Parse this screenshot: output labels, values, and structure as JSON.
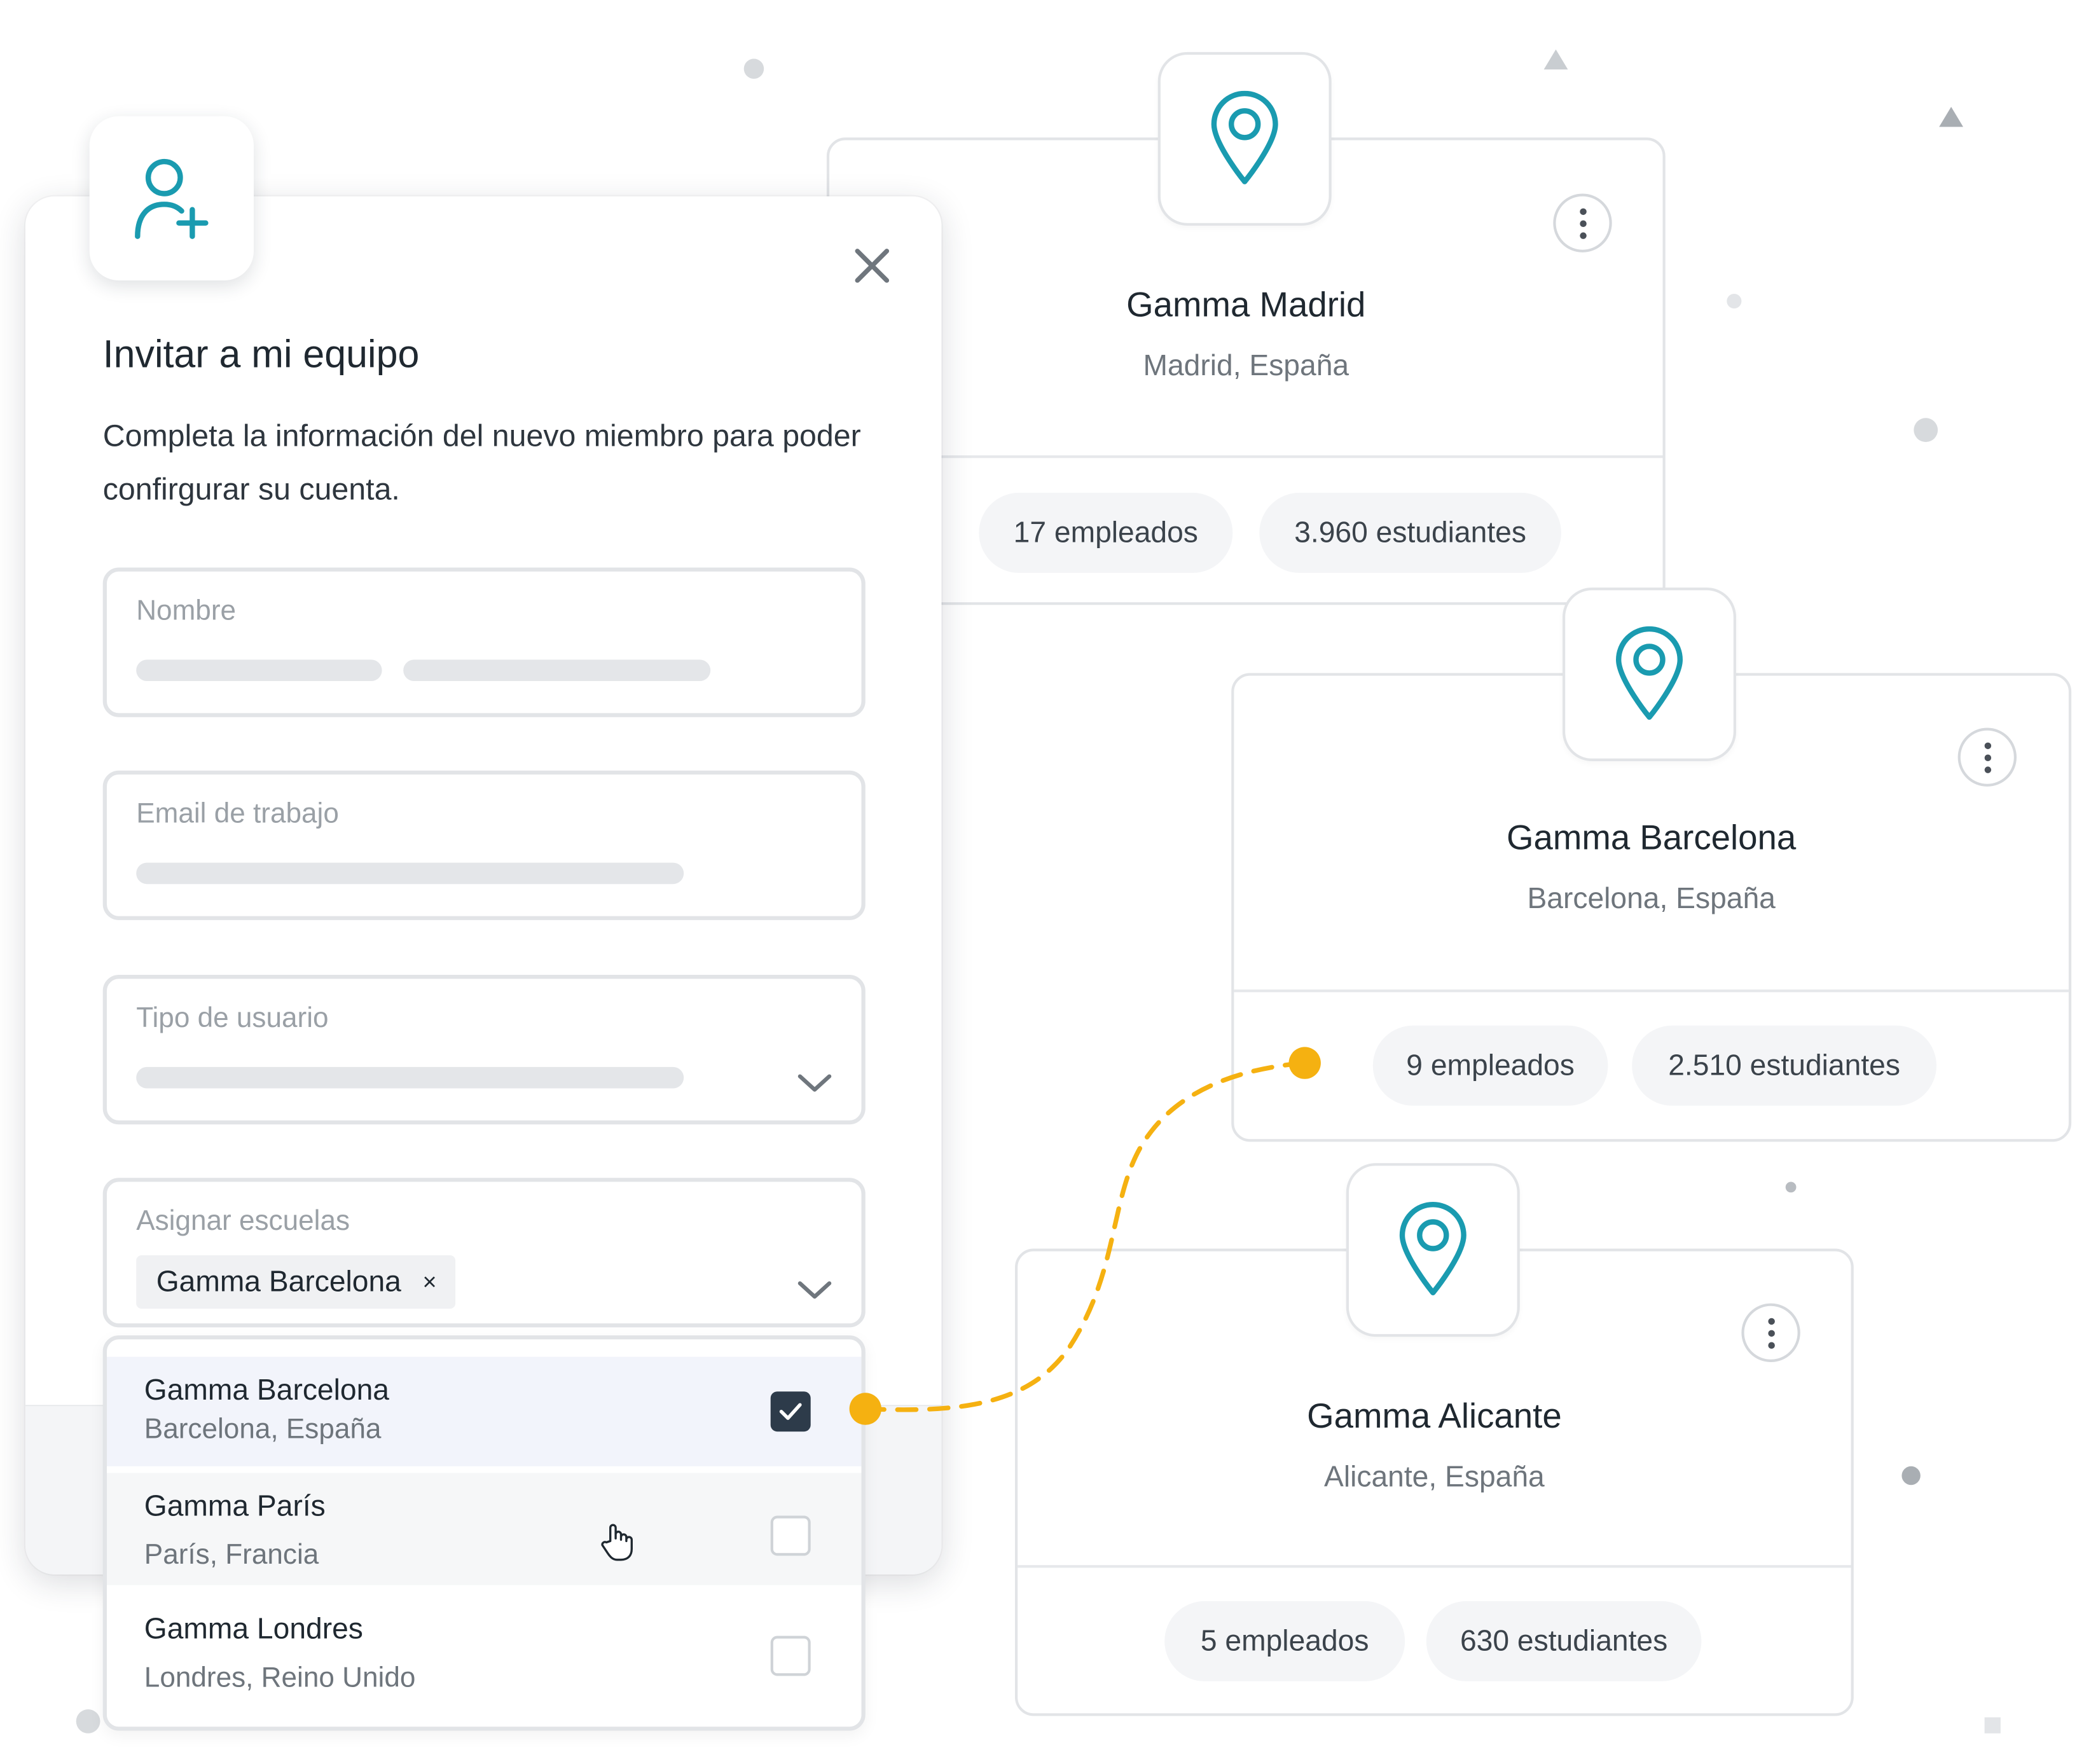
{
  "modal": {
    "title": "Invitar a mi equipo",
    "description": "Completa la información del nuevo miembro para poder confirgurar su cuenta.",
    "avatar_icon": "user-plus-icon",
    "close_icon": "close-icon",
    "fields": {
      "name_label": "Nombre",
      "email_label": "Email de trabajo",
      "user_type_label": "Tipo de usuario",
      "schools_label": "Asignar escuelas",
      "selected_school_tag": "Gamma Barcelona",
      "tag_remove": "×"
    },
    "dropdown_options": [
      {
        "name": "Gamma Barcelona",
        "location": "Barcelona, España",
        "checked": true
      },
      {
        "name": "Gamma París",
        "location": "París, Francia",
        "checked": false
      },
      {
        "name": "Gamma Londres",
        "location": "Londres, Reino Unido",
        "checked": false
      }
    ]
  },
  "cards": {
    "madrid": {
      "title": "Gamma Madrid",
      "location": "Madrid, España",
      "employees": "17 empleados",
      "students": "3.960 estudiantes"
    },
    "barcelona": {
      "title": "Gamma Barcelona",
      "location": "Barcelona, España",
      "employees": "9 empleados",
      "students": "2.510 estudiantes"
    },
    "alicante": {
      "title": "Gamma Alicante",
      "location": "Alicante, España",
      "employees": "5 empleados",
      "students": "630 estudiantes"
    }
  },
  "colors": {
    "accent_teal": "#1a9bb0",
    "connector_yellow": "#f5b111",
    "checkbox_dark": "#2d3b4a",
    "selected_row_bg": "#f2f4fb"
  }
}
